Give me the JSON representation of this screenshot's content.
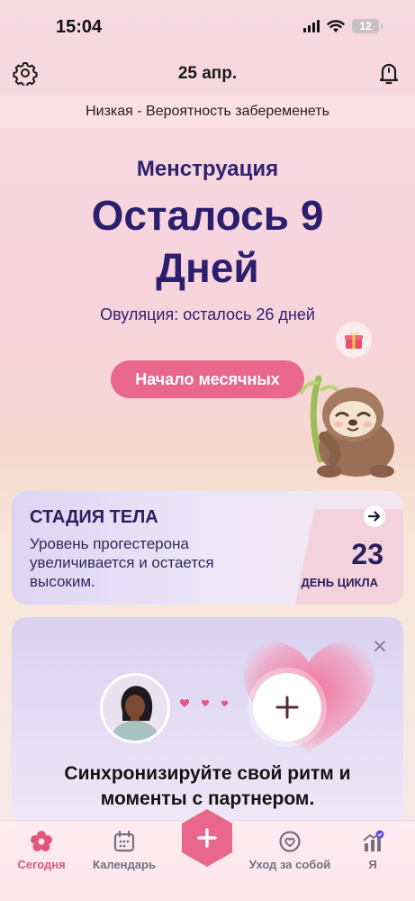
{
  "status_bar": {
    "time": "15:04",
    "battery": "12"
  },
  "header": {
    "date": "25 апр."
  },
  "pregnancy_chance": "Низкая - Вероятность забеременеть",
  "hero": {
    "subtitle": "Менструация",
    "countdown": "Осталось 9 Дней",
    "ovulation": "Овуляция: осталось 26 дней",
    "start_button": "Начало месячных"
  },
  "body_stage": {
    "title": "СТАДИЯ ТЕЛА",
    "text": "Уровень прогестерона увеличивается и остается высоким.",
    "cycle_day": "23",
    "cycle_day_label": "ДЕНЬ ЦИКЛА"
  },
  "partner": {
    "text": "Синхронизируйте свой ритм и моменты с партнером."
  },
  "tabs": [
    {
      "label": "Сегодня",
      "icon": "flower-icon",
      "active": true
    },
    {
      "label": "Календарь",
      "icon": "calendar-icon",
      "active": false
    },
    {
      "label": "Уход за собой",
      "icon": "heart-circle-icon",
      "active": false
    },
    {
      "label": "Я",
      "icon": "chart-icon",
      "active": false
    }
  ],
  "colors": {
    "accent": "#e9678d",
    "primary_text": "#2b1f6e"
  }
}
